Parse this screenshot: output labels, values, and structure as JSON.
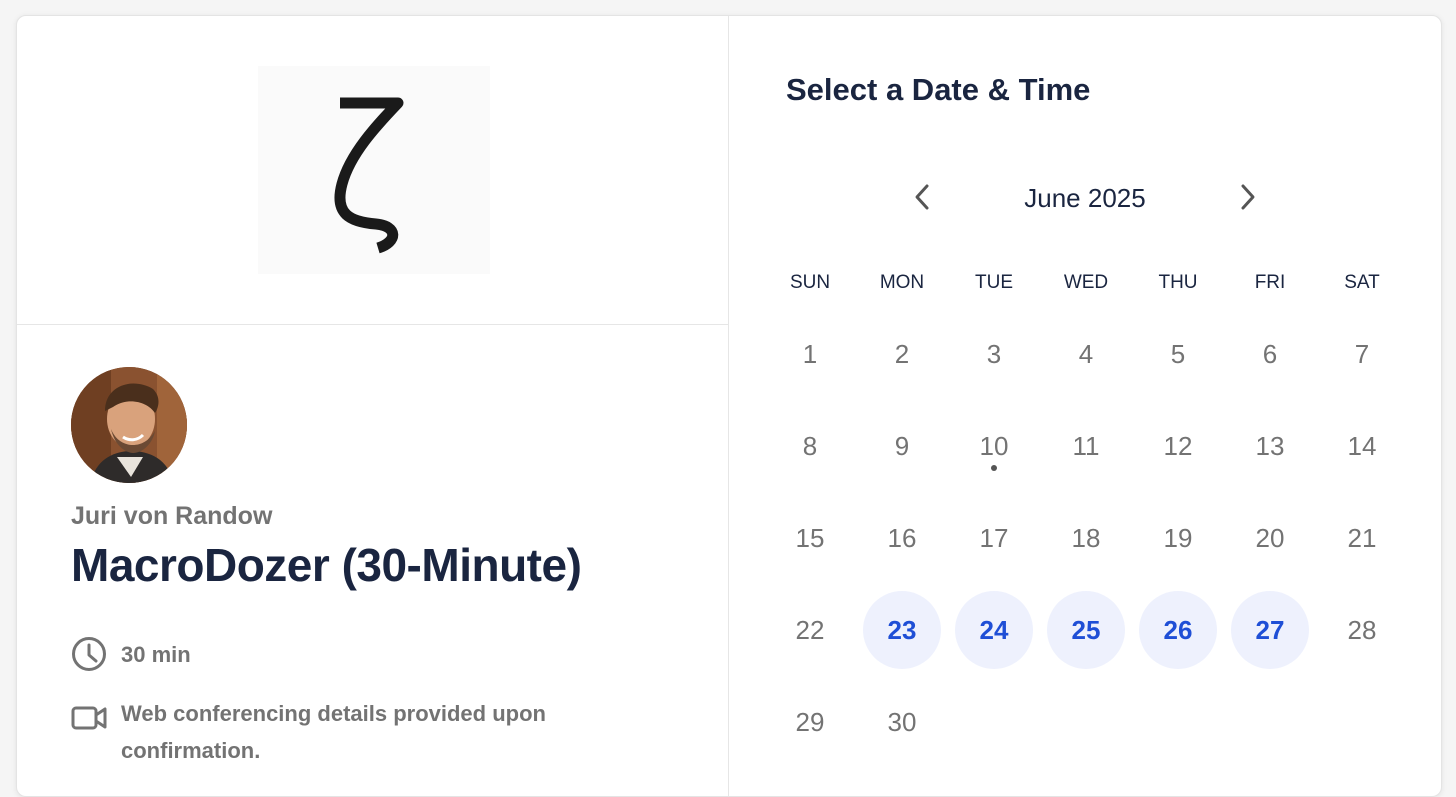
{
  "host": {
    "name": "Juri von Randow"
  },
  "event": {
    "title": "MacroDozer (30-Minute)",
    "duration": "30 min",
    "conferencing": "Web conferencing details provided upon confirmation."
  },
  "calendar": {
    "section_title": "Select a Date & Time",
    "month_label": "June 2025",
    "weekdays": [
      "SUN",
      "MON",
      "TUE",
      "WED",
      "THU",
      "FRI",
      "SAT"
    ],
    "days": [
      {
        "label": "1",
        "available": false,
        "today": false
      },
      {
        "label": "2",
        "available": false,
        "today": false
      },
      {
        "label": "3",
        "available": false,
        "today": false
      },
      {
        "label": "4",
        "available": false,
        "today": false
      },
      {
        "label": "5",
        "available": false,
        "today": false
      },
      {
        "label": "6",
        "available": false,
        "today": false
      },
      {
        "label": "7",
        "available": false,
        "today": false
      },
      {
        "label": "8",
        "available": false,
        "today": false
      },
      {
        "label": "9",
        "available": false,
        "today": false
      },
      {
        "label": "10",
        "available": false,
        "today": true
      },
      {
        "label": "11",
        "available": false,
        "today": false
      },
      {
        "label": "12",
        "available": false,
        "today": false
      },
      {
        "label": "13",
        "available": false,
        "today": false
      },
      {
        "label": "14",
        "available": false,
        "today": false
      },
      {
        "label": "15",
        "available": false,
        "today": false
      },
      {
        "label": "16",
        "available": false,
        "today": false
      },
      {
        "label": "17",
        "available": false,
        "today": false
      },
      {
        "label": "18",
        "available": false,
        "today": false
      },
      {
        "label": "19",
        "available": false,
        "today": false
      },
      {
        "label": "20",
        "available": false,
        "today": false
      },
      {
        "label": "21",
        "available": false,
        "today": false
      },
      {
        "label": "22",
        "available": false,
        "today": false
      },
      {
        "label": "23",
        "available": true,
        "today": false
      },
      {
        "label": "24",
        "available": true,
        "today": false
      },
      {
        "label": "25",
        "available": true,
        "today": false
      },
      {
        "label": "26",
        "available": true,
        "today": false
      },
      {
        "label": "27",
        "available": true,
        "today": false
      },
      {
        "label": "28",
        "available": false,
        "today": false
      },
      {
        "label": "29",
        "available": false,
        "today": false
      },
      {
        "label": "30",
        "available": false,
        "today": false
      }
    ]
  },
  "icons": {
    "logo": "zeta-logo",
    "duration": "clock-icon",
    "conferencing": "video-camera-icon",
    "prev": "chevron-left-icon",
    "next": "chevron-right-icon"
  },
  "colors": {
    "accent": "#1f4fd6",
    "available_bg": "#eef1fd",
    "title": "#1a2540",
    "muted": "#737373"
  }
}
